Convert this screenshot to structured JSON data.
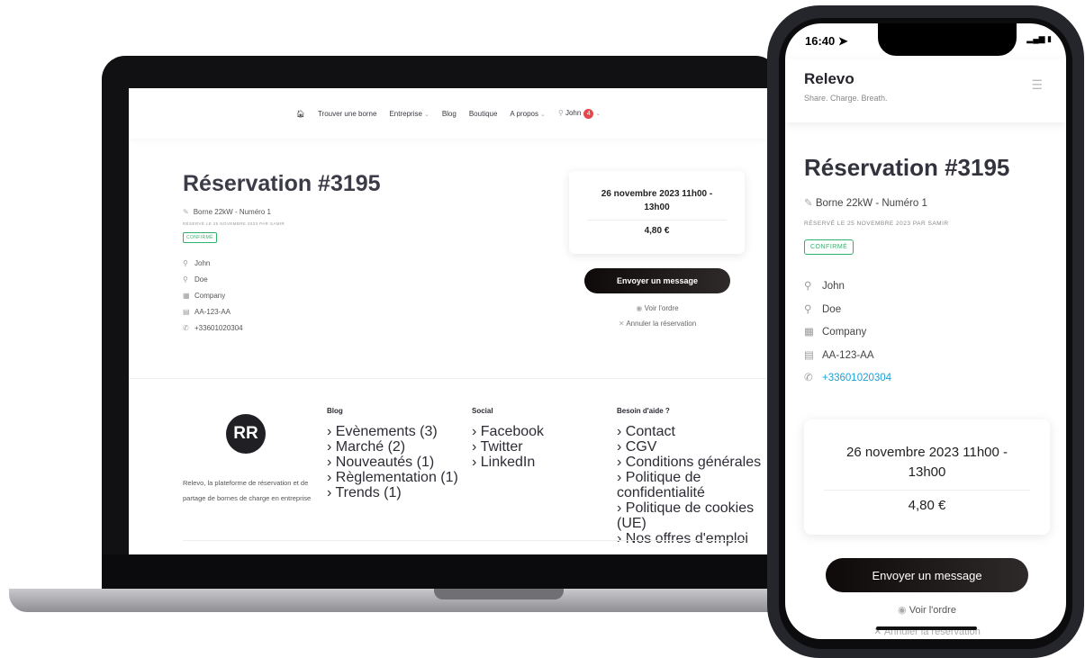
{
  "nav": {
    "items": [
      "Trouver une borne",
      "Entreprise",
      "Blog",
      "Boutique",
      "A propos"
    ],
    "user": "John",
    "notif_count": "4"
  },
  "reservation": {
    "title": "Réservation #3195",
    "borne": "Borne 22kW - Numéro 1",
    "reserved_by": "RÉSERVÉ LE 25 NOVEMBRE 2023 PAR SAMIR",
    "status": "CONFIRMÉ",
    "first_name": "John",
    "last_name": "Doe",
    "company": "Company",
    "plate": "AA-123-AA",
    "phone": "+33601020304",
    "date": "26 novembre 2023 11h00 - 13h00",
    "date_line1": "26 novembre 2023 11h00 -",
    "date_line2": "13h00",
    "price": "4,80 €",
    "send_message": "Envoyer un message",
    "view_order": "Voir l'ordre",
    "cancel": "Annuler la réservation"
  },
  "footer": {
    "logo_text": "RR",
    "about": "Relevo, la plateforme de réservation et de partage de bornes de charge en entreprise",
    "blog_title": "Blog",
    "blog_items": [
      "Evènements (3)",
      "Marché (2)",
      "Nouveautés (1)",
      "Règlementation (1)",
      "Trends (1)"
    ],
    "social_title": "Social",
    "social_items": [
      "Facebook",
      "Twitter",
      "LinkedIn"
    ],
    "help_title": "Besoin d'aide ?",
    "help_items": [
      "Contact",
      "CGV",
      "Conditions générales",
      "Politique de confidentialité",
      "Politique de cookies (UE)",
      "Nos offres d'emploi"
    ]
  },
  "phone": {
    "time": "16:40",
    "brand": "Relevo",
    "tagline": "Share. Charge. Breath."
  },
  "colors": {
    "confirm_green": "#2fb36c",
    "link_blue": "#1aa0d8",
    "badge_red": "#e5484d"
  }
}
